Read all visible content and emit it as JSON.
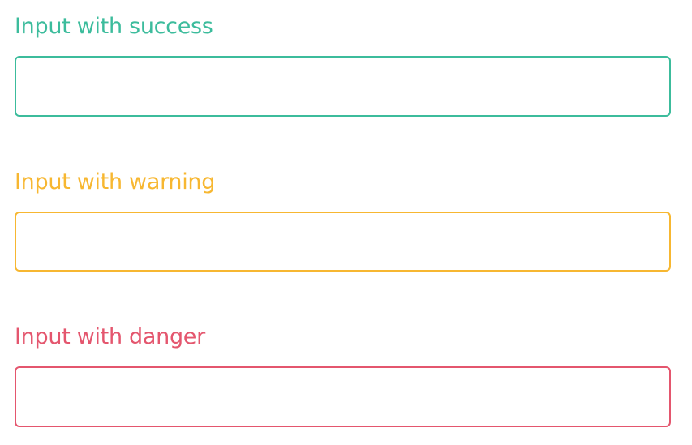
{
  "form": {
    "fields": [
      {
        "id": "success",
        "label": "Input with success",
        "value": "",
        "placeholder": "",
        "color": "#3cbc9c"
      },
      {
        "id": "warning",
        "label": "Input with warning",
        "value": "",
        "placeholder": "",
        "color": "#f7b731"
      },
      {
        "id": "danger",
        "label": "Input with danger",
        "value": "",
        "placeholder": "",
        "color": "#e4566e"
      }
    ]
  }
}
